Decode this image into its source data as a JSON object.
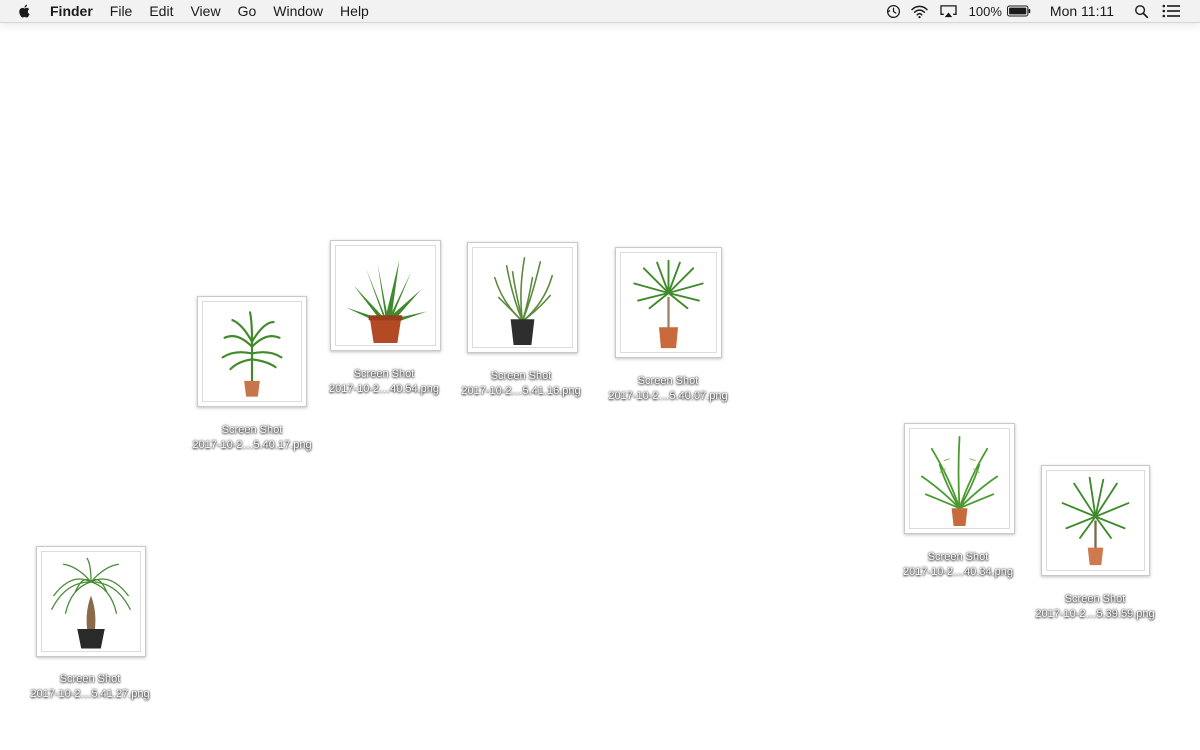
{
  "menubar": {
    "app_name": "Finder",
    "menus": [
      "File",
      "Edit",
      "View",
      "Go",
      "Window",
      "Help"
    ],
    "battery_percent": "100%",
    "clock": "Mon 11:11"
  },
  "desktop": {
    "files": [
      {
        "line1": "Screen Shot",
        "line2": "2017-10-2…5.40.17.png",
        "pot_color": "#c8754a"
      },
      {
        "line1": "Screen Shot",
        "line2": "2017-10-2…40.54.png",
        "pot_color": "#b34a24"
      },
      {
        "line1": "Screen Shot",
        "line2": "2017-10-2…5.41.16.png",
        "pot_color": "#2e2e2e"
      },
      {
        "line1": "Screen Shot",
        "line2": "2017-10-2…5.40.07.png",
        "pot_color": "#c86a3c"
      },
      {
        "line1": "Screen Shot",
        "line2": "2017-10-2…40.34.png",
        "pot_color": "#c86a3c"
      },
      {
        "line1": "Screen Shot",
        "line2": "2017-10-2…5.39.59.png",
        "pot_color": "#d0784e"
      },
      {
        "line1": "Screen Shot",
        "line2": "2017-10-2…5.41.27.png",
        "pot_color": "#2a2a2a"
      }
    ]
  },
  "colors": {
    "menubar_bg": "#f2f2f2",
    "leaf_green": "#3f8a2a"
  },
  "icons": [
    "apple-icon",
    "time-machine-icon",
    "wifi-icon",
    "airplay-icon",
    "battery-icon",
    "spotlight-search-icon",
    "notification-center-icon"
  ]
}
